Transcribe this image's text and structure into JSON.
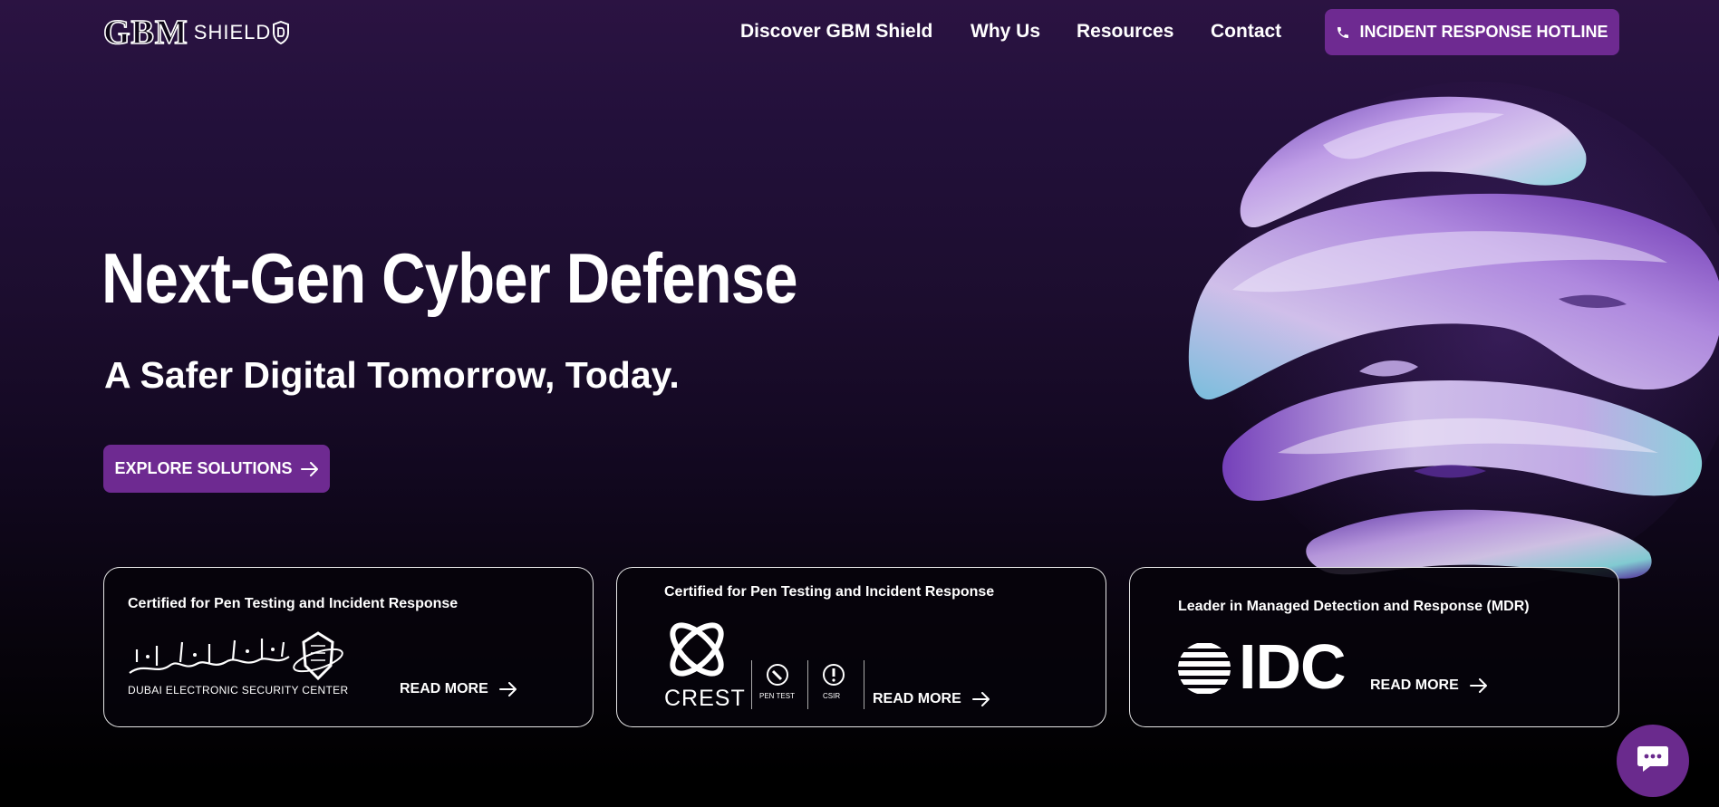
{
  "header": {
    "logo": {
      "brand": "GBM",
      "product": "SHIELD"
    },
    "nav": [
      {
        "label": "Discover GBM Shield"
      },
      {
        "label": "Why Us"
      },
      {
        "label": "Resources"
      },
      {
        "label": "Contact"
      }
    ],
    "hotline": {
      "label": "INCIDENT RESPONSE HOTLINE",
      "icon": "phone-icon"
    }
  },
  "hero": {
    "title": "Next-Gen Cyber Defense",
    "subtitle": "A Safer Digital Tomorrow, Today.",
    "cta": {
      "label": "EXPLORE SOLUTIONS",
      "icon": "arrow-right-icon"
    }
  },
  "cards": [
    {
      "caption": "Certified for Pen Testing and Incident Response",
      "logo": "dubai-electronic-security-center-logo",
      "logo_text": "DUBAI ELECTRONIC SECURITY CENTER",
      "read_more": "READ MORE"
    },
    {
      "caption": "Certified for Pen Testing and Incident Response",
      "logo": "crest-logo",
      "logo_text": "CREST",
      "badges": [
        "PEN TEST",
        "CSIR"
      ],
      "read_more": "READ MORE"
    },
    {
      "caption": "Leader in Managed Detection and Response (MDR)",
      "logo": "idc-logo",
      "logo_text": "IDC",
      "read_more": "READ MORE"
    }
  ],
  "chat": {
    "icon": "chat-bubble-icon"
  },
  "colors": {
    "accent": "#6e2a91",
    "background_top": "#2b1342",
    "background_bottom": "#000000",
    "text": "#ffffff"
  }
}
